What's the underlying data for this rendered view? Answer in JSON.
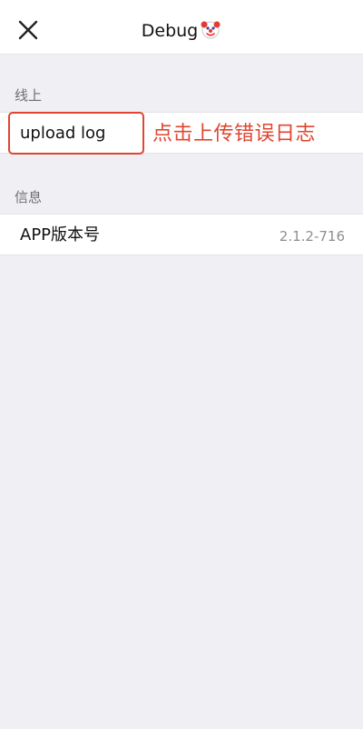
{
  "navbar": {
    "title": "Debug",
    "emoji_icon": "clown-face-icon"
  },
  "online_section": {
    "header": "线上",
    "upload_button_label": "upload log",
    "annotation": "点击上传错误日志",
    "annotation_color": "#e0452f"
  },
  "info_section": {
    "header": "信息",
    "app_version_label": "APP版本号",
    "app_version_value": "2.1.2-716"
  }
}
